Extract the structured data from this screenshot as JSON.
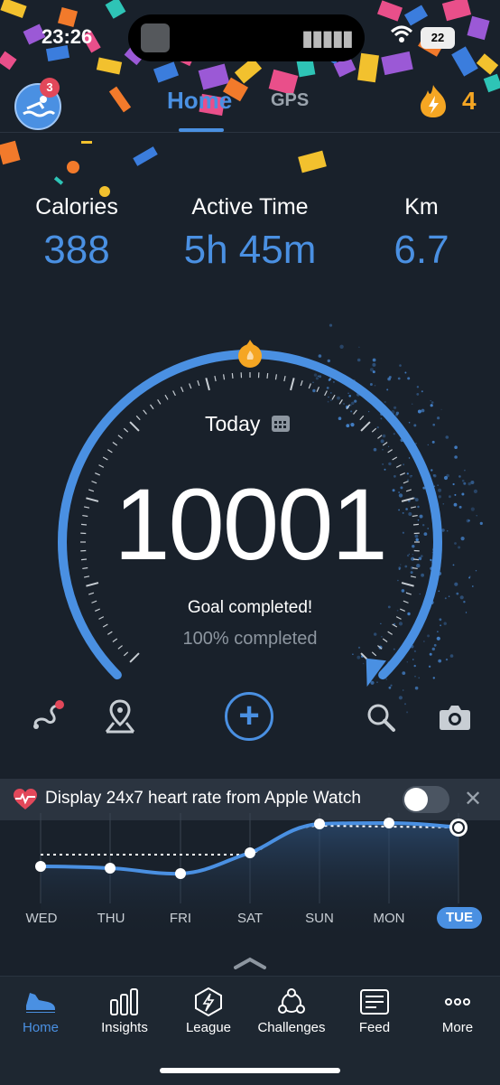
{
  "status_bar": {
    "time": "23:26",
    "battery": "22"
  },
  "header": {
    "avatar_badge": "3",
    "tabs": [
      {
        "label": "Home",
        "active": true
      },
      {
        "label": "GPS",
        "active": false
      }
    ],
    "streak_count": "4"
  },
  "stats": [
    {
      "label": "Calories",
      "value": "388"
    },
    {
      "label": "Active Time",
      "value": "5h 45m"
    },
    {
      "label": "Km",
      "value": "6.7"
    }
  ],
  "gauge": {
    "day_label": "Today",
    "steps": "10001",
    "goal_text": "Goal completed!",
    "progress_text": "100% completed",
    "progress": 1.0
  },
  "actions": {
    "route_icon": "route-icon",
    "map_pin_icon": "map-pin-icon",
    "add_label": "+",
    "search_icon": "search-icon",
    "camera_icon": "camera-icon"
  },
  "heart_rate_banner": {
    "text": "Display 24x7 heart rate from Apple Watch",
    "close": "✕",
    "enabled": false
  },
  "week": {
    "days": [
      "WED",
      "THU",
      "FRI",
      "SAT",
      "SUN",
      "MON",
      "TUE"
    ],
    "selected": "TUE"
  },
  "nav": [
    {
      "label": "Home",
      "icon": "shoe-icon",
      "active": true
    },
    {
      "label": "Insights",
      "icon": "bar-chart-icon",
      "active": false
    },
    {
      "label": "League",
      "icon": "league-badge-icon",
      "active": false
    },
    {
      "label": "Challenges",
      "icon": "challenges-icon",
      "active": false
    },
    {
      "label": "Feed",
      "icon": "feed-icon",
      "active": false
    },
    {
      "label": "More",
      "icon": "more-icon",
      "active": false
    }
  ],
  "colors": {
    "accent": "#4a90e2",
    "background": "#19212b",
    "streak": "#f5a623"
  }
}
